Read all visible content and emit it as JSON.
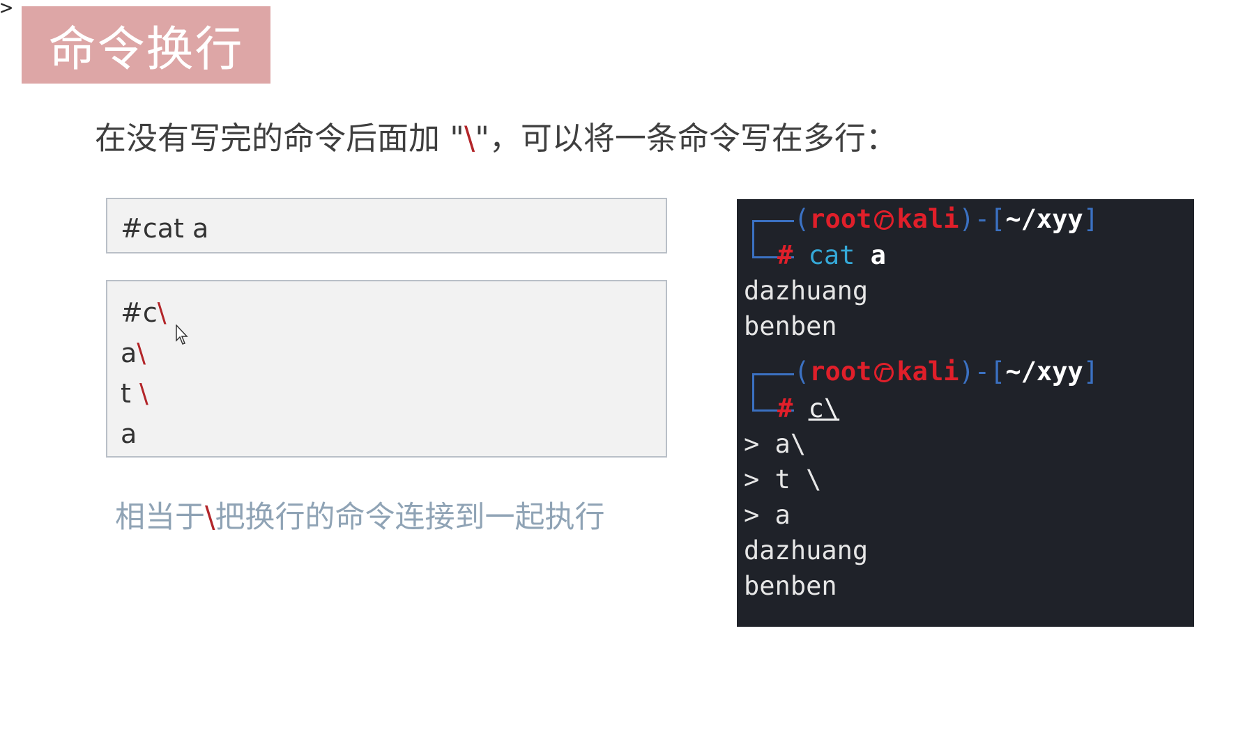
{
  "corner_mark": ">",
  "title": "命令换行",
  "subtitle": {
    "before": "在没有写完的命令后面加 \"",
    "accent": "\\",
    "after": "\"，可以将一条命令写在多行："
  },
  "single_command": "#cat a",
  "multi_command": [
    {
      "text": "#c",
      "bs": "\\"
    },
    {
      "text": "a",
      "bs": "\\"
    },
    {
      "text": "t ",
      "bs": "\\"
    },
    {
      "text": "a",
      "bs": ""
    }
  ],
  "note": {
    "before": "相当于",
    "accent": "\\",
    "after": "把换行的命令连接到一起执行"
  },
  "terminal": {
    "prompt1": {
      "open": "(",
      "user": "root",
      "host": "kali",
      "mid": ")-[",
      "path": "~/xyy",
      "close": "]",
      "hash": "#",
      "cmd": "cat",
      "arg": "a"
    },
    "out1": [
      "dazhuang",
      "benben"
    ],
    "prompt2": {
      "open": "(",
      "user": "root",
      "host": "kali",
      "mid": ")-[",
      "path": "~/xyy",
      "close": "]",
      "hash": "#",
      "cmd": "c\\"
    },
    "cont": [
      "> a\\",
      "> t \\",
      "> a"
    ],
    "out2": [
      "dazhuang",
      "benben"
    ]
  }
}
